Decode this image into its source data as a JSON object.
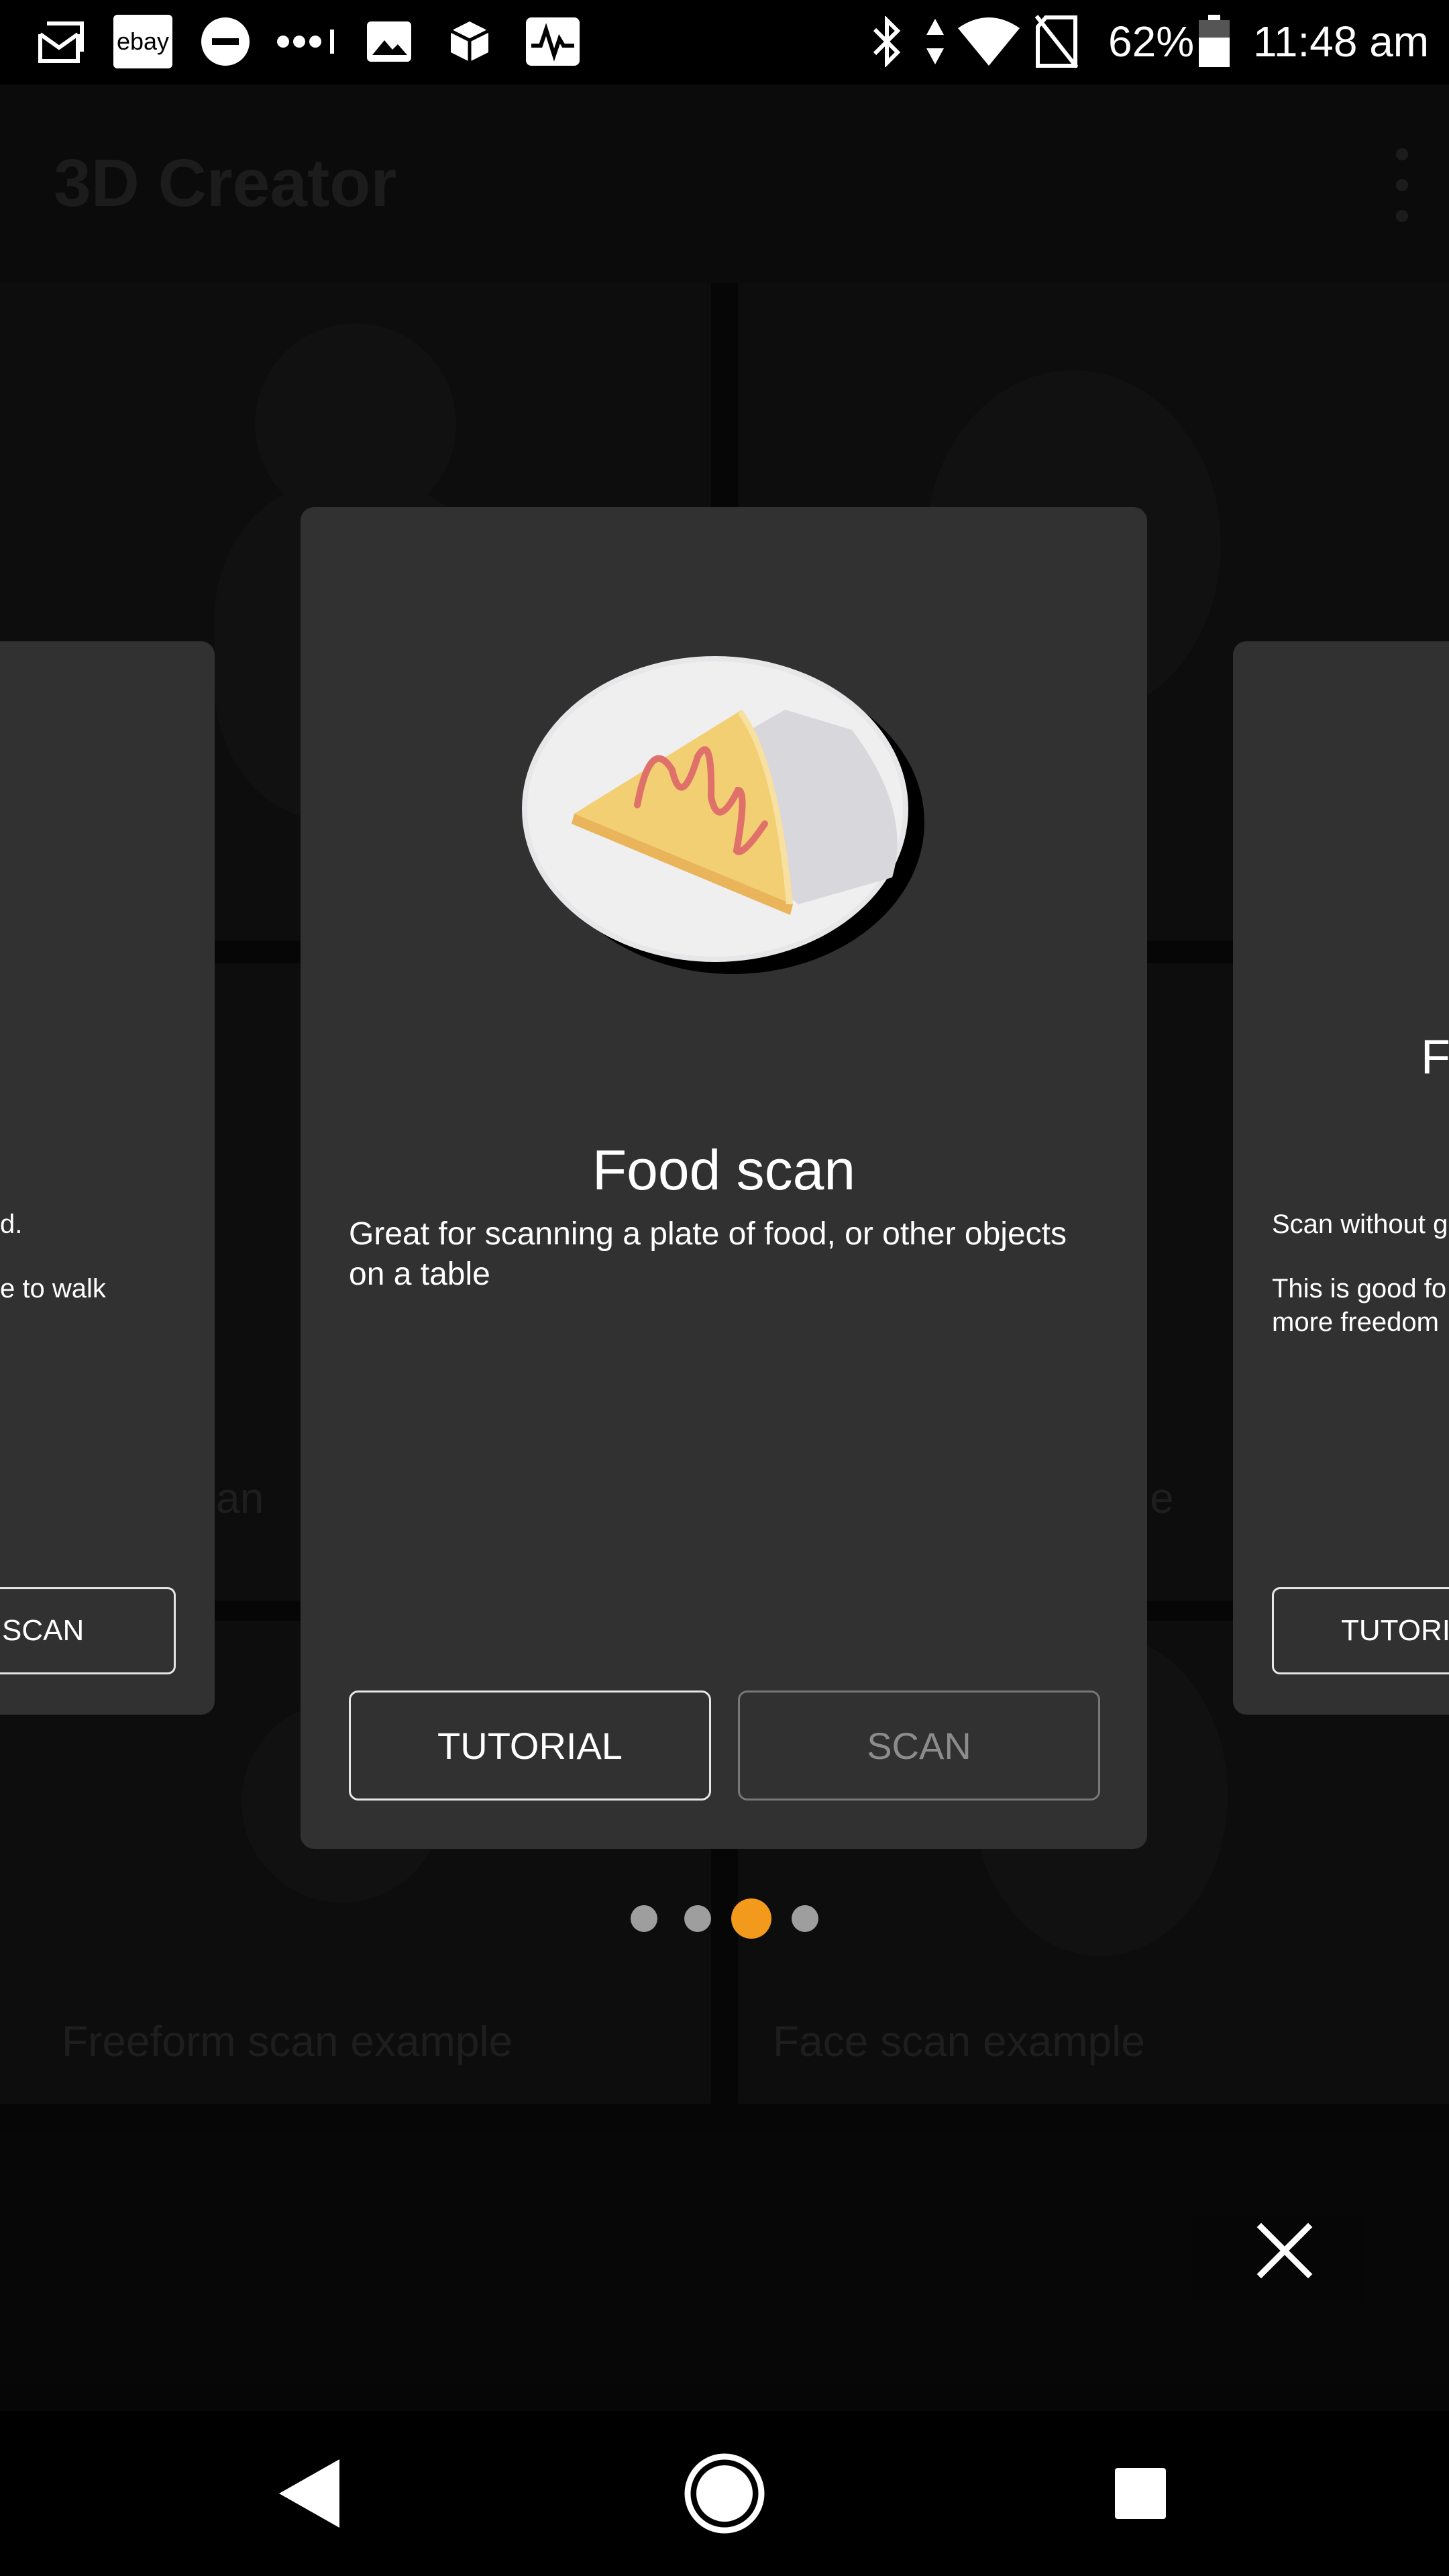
{
  "status_bar": {
    "battery": "62%",
    "time": "11:48 am",
    "left_icons": [
      "mail-icon",
      "ebay-icon",
      "do-not-disturb-icon",
      "signal-dots-icon",
      "image-icon",
      "box-icon",
      "activity-icon"
    ],
    "ebay_text": "ebay",
    "right_icons": [
      "bluetooth-icon",
      "data-arrows-icon",
      "wifi-icon",
      "no-sim-icon",
      "battery-icon"
    ]
  },
  "app": {
    "title": "3D Creator",
    "tiles": [
      {
        "label": "Freeform scan example"
      },
      {
        "label": "Face scan example"
      }
    ],
    "partial_labels": [
      "can",
      "le"
    ]
  },
  "dialog": {
    "current_card": {
      "title": "Food scan",
      "description": "Great for scanning a plate of food, or other objects on a table",
      "tutorial_label": "TUTORIAL",
      "scan_label": "SCAN",
      "illustration": "food-plate-illustration"
    },
    "left_card": {
      "line1": "d.",
      "line2": "e to walk",
      "scan_label": "SCAN"
    },
    "right_card": {
      "title_fragment": "F",
      "line1": "Scan without g",
      "line2": "This is good fo",
      "line3": "more freedom",
      "tutorial_label": "TUTORI"
    },
    "pager": {
      "count": 4,
      "active_index": 2
    },
    "close_icon": "close-icon"
  },
  "nav_bar": {
    "buttons": [
      "back-icon",
      "home-icon",
      "recents-icon"
    ]
  },
  "colors": {
    "accent": "#f39a1d",
    "card_bg": "#313131"
  }
}
